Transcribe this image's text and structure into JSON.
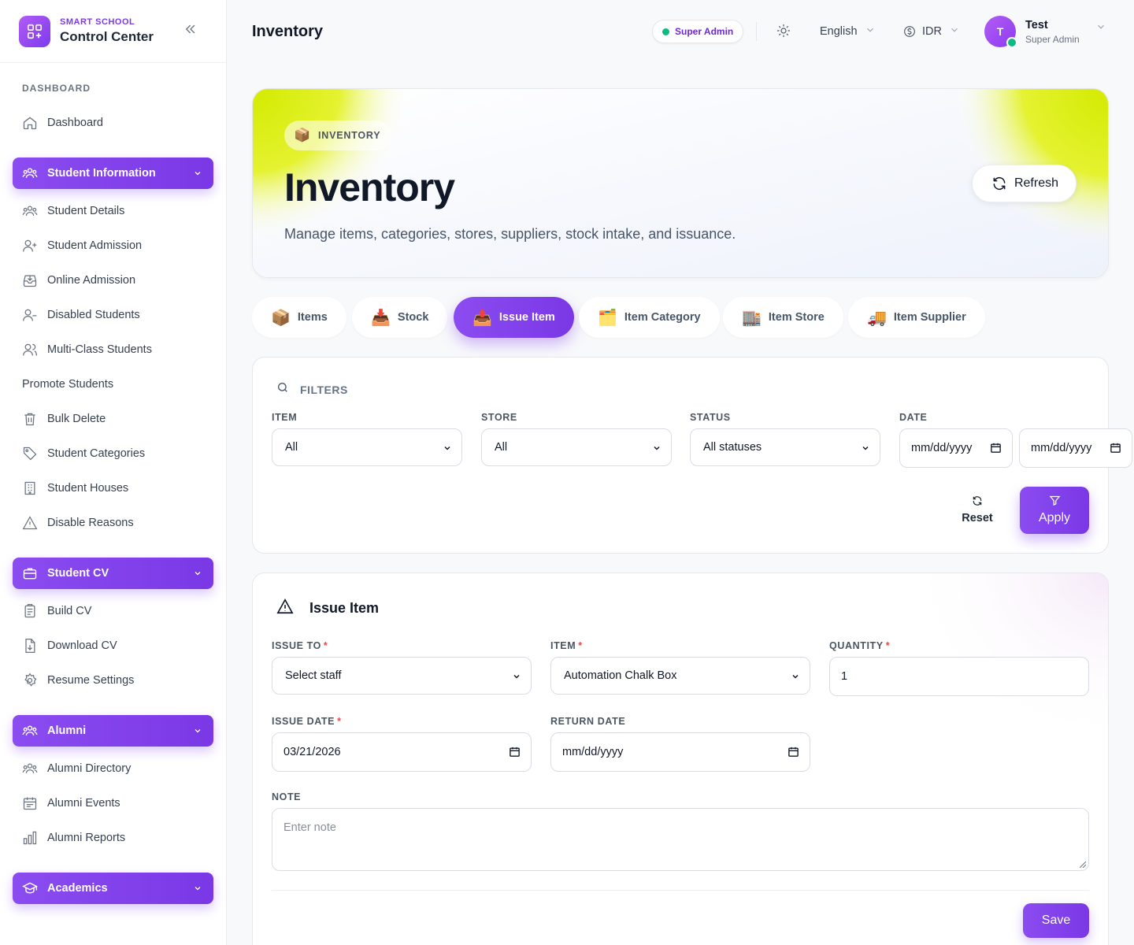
{
  "brand": {
    "small": "SMART SCHOOL",
    "big": "Control Center"
  },
  "sidebar": {
    "section": "DASHBOARD",
    "dashboard": "Dashboard",
    "student_information": "Student Information",
    "student_items": [
      "Student Details",
      "Student Admission",
      "Online Admission",
      "Disabled Students",
      "Multi-Class Students",
      "Promote Students",
      "Bulk Delete",
      "Student Categories",
      "Student Houses",
      "Disable Reasons"
    ],
    "student_cv": "Student CV",
    "cv_items": [
      "Build CV",
      "Download CV",
      "Resume Settings"
    ],
    "alumni": "Alumni",
    "alumni_items": [
      "Alumni Directory",
      "Alumni Events",
      "Alumni Reports"
    ],
    "academics": "Academics"
  },
  "header": {
    "title": "Inventory",
    "role_badge": "Super Admin",
    "language": "English",
    "currency": "IDR",
    "user_initial": "T",
    "user_name": "Test",
    "user_role": "Super Admin"
  },
  "hero": {
    "pill": "INVENTORY",
    "pill_emoji": "📦",
    "title": "Inventory",
    "subtitle": "Manage items, categories, stores, suppliers, stock intake, and issuance.",
    "refresh": "Refresh"
  },
  "tabs": [
    {
      "emoji": "📦",
      "label": "Items"
    },
    {
      "emoji": "📥",
      "label": "Stock"
    },
    {
      "emoji": "📤",
      "label": "Issue Item",
      "active": true
    },
    {
      "emoji": "🗂️",
      "label": "Item Category"
    },
    {
      "emoji": "🏬",
      "label": "Item Store"
    },
    {
      "emoji": "🚚",
      "label": "Item Supplier"
    }
  ],
  "filters": {
    "title": "FILTERS",
    "item_label": "ITEM",
    "item_value": "All",
    "store_label": "STORE",
    "store_value": "All",
    "status_label": "STATUS",
    "status_value": "All statuses",
    "date_label": "DATE",
    "date_from": "mm/dd/yyyy",
    "date_to": "mm/dd/yyyy",
    "reset": "Reset",
    "apply": "Apply"
  },
  "issue": {
    "title": "Issue Item",
    "issue_to_label": "ISSUE TO",
    "issue_to_value": "Select staff",
    "item_label": "ITEM",
    "item_value": "Automation Chalk Box",
    "quantity_label": "QUANTITY",
    "quantity_value": "1",
    "issue_date_label": "ISSUE DATE",
    "issue_date_value": "03/21/2026",
    "return_date_label": "RETURN DATE",
    "return_date_value": "mm/dd/yyyy",
    "note_label": "NOTE",
    "note_placeholder": "Enter note",
    "required_mark": "*",
    "save": "Save"
  },
  "colors": {
    "accent": "#7c3aed",
    "online": "#10b981",
    "required": "#ef4444",
    "hero_lime": "#d9ec00"
  }
}
